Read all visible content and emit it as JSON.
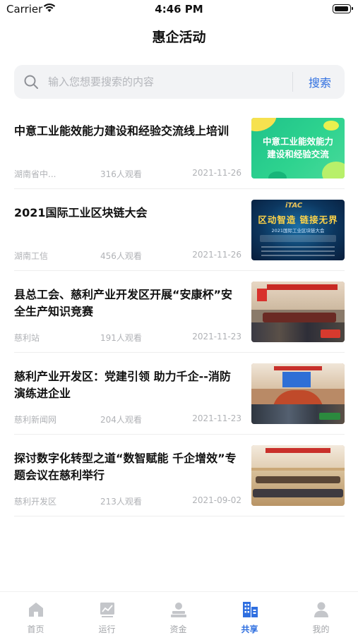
{
  "status_bar": {
    "carrier": "Carrier",
    "time": "4:46 PM"
  },
  "nav": {
    "title": "惠企活动"
  },
  "search": {
    "placeholder": "输入您想要搜索的内容",
    "button_label": "搜索"
  },
  "news": [
    {
      "title": "中意工业能效能力建设和经验交流线上培训",
      "source": "湖南省中...",
      "views": "316人观看",
      "date": "2021-11-26",
      "thumb_text": [
        "中意工业能效能力",
        "建设和经验交流"
      ]
    },
    {
      "title": "2021国际工业区块链大会",
      "source": "湖南工信",
      "views": "456人观看",
      "date": "2021-11-26",
      "thumb_text": [
        "iTAC",
        "区动智造 链接无界",
        "2021国际工业区块链大会"
      ]
    },
    {
      "title": "县总工会、慈利产业开发区开展“安康杯”安全生产知识竞赛",
      "source": "慈利站",
      "views": "191人观看",
      "date": "2021-11-23"
    },
    {
      "title": "慈利产业开发区：党建引领 助力千企--消防演练进企业",
      "source": "慈利新闻网",
      "views": "204人观看",
      "date": "2021-11-23"
    },
    {
      "title": "探讨数字化转型之道“数智赋能 千企增效”专题会议在慈利举行",
      "source": "慈利开发区",
      "views": "213人观看",
      "date": "2021-09-02"
    }
  ],
  "tabs": [
    {
      "label": "首页",
      "icon": "home-icon"
    },
    {
      "label": "运行",
      "icon": "chart-icon"
    },
    {
      "label": "资金",
      "icon": "funds-icon"
    },
    {
      "label": "共享",
      "icon": "share-building-icon",
      "active": true
    },
    {
      "label": "我的",
      "icon": "user-icon"
    }
  ],
  "colors": {
    "accent": "#2f6fe0",
    "muted": "#b0b2b6",
    "search_bg": "#f2f3f5",
    "tab_inactive": "#a2a4a8"
  }
}
